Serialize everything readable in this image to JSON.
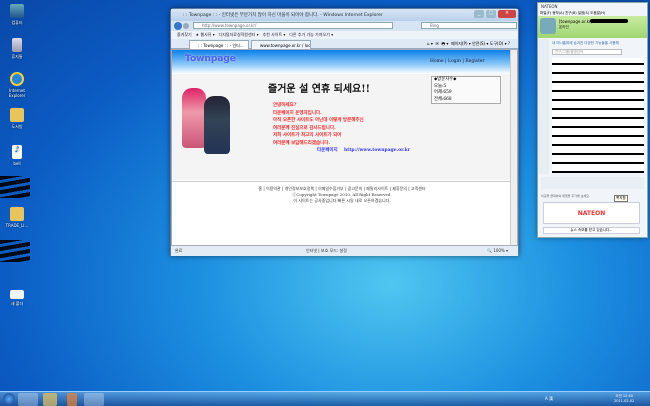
{
  "desktop": {
    "icons": [
      {
        "label": "컴퓨터",
        "icon": "computer-icon"
      },
      {
        "label": "휴지통",
        "icon": "recycle-bin-icon"
      },
      {
        "label": "Internet Explorer",
        "icon": "ie-icon"
      },
      {
        "label": "도서방",
        "icon": "folder-icon"
      },
      {
        "label": "bell",
        "icon": "music-file-icon"
      },
      {
        "label": "TRADE_LI...",
        "icon": "folder-icon"
      },
      {
        "label": "새 폴더",
        "icon": "folder-icon"
      }
    ]
  },
  "ie": {
    "title": ": : Townpage : : - 인터넷은 부분가치 많이 하신 마을이 되어야 합니다. - Windows Internet Explorer",
    "url": "http://www.townpage.or.kr/",
    "search_placeholder": "Bing",
    "favorites": [
      "즐겨찾기",
      "웹사뮤",
      "디지털자료실적원센터",
      "추천 사이트",
      "다른 추가 가능 가져오기"
    ],
    "tabs": [
      ": : Townpage : : - 인터...",
      "www.townpage.or.kr / loc..."
    ],
    "commands": [
      "페이지(P)",
      "안전(S)",
      "도구(O)"
    ],
    "status_left": "완료",
    "status_zone": "인터넷 | 보호 모드: 설정",
    "zoom": "100%"
  },
  "page": {
    "logo": "Townpage",
    "nav": [
      "Home",
      "Login",
      "Register"
    ],
    "headline": "즐거운 설 연휴 되세요!!",
    "counter": {
      "title": "◆방문자수◆",
      "today": "오늘:5",
      "yesterday": "어제:659",
      "total": "전체:668"
    },
    "greeting": [
      "안녕하세요?",
      "타운페이지 운영자입니다.",
      "아직 오픈한 사이트도 아닌데 이렇게 방문해주신",
      "여러분께 진심으로 감사드립니다.",
      "저희 사이트가 최고의 사이트가 되어",
      "여러분께 보답해드리겠습니다."
    ],
    "signature_name": "타운페이지",
    "signature_url": "http://www.townpage.or.kr",
    "footer_links": [
      "홈",
      "이용약관",
      "개인정보보호정책",
      "이메일수집거부",
      "광고문의",
      "패밀리사이트",
      "제휴문의",
      "고객센터"
    ],
    "copyright": "ⓒCopyright Townpage 2010. All Right Reserved.",
    "notice": "이 사이트는 공사중입니다.빠른 시일 내로 오픈하겠습니다."
  },
  "nate": {
    "app": "NATEON",
    "menu": [
      "파일(F)",
      "동작(A)",
      "친구(B)",
      "설정(S)",
      "도움말(H)"
    ],
    "account": "[townpage.or.kr]",
    "status": "온라인",
    "notice": "내 미니홈피에 숨겨진 다양한 기능들을 사용해",
    "search_placeholder": "친구/그룹/별명검색",
    "tooltip": "쪽지함",
    "ad_text": "이곳을 클릭하여 위젯을 추가해 보세요",
    "logo": "NATEON",
    "news": "뉴스 속보를 받고 있습니다..."
  },
  "taskbar": {
    "time": "오전 12:40",
    "date": "2011-02-02",
    "ime": "A 漢"
  }
}
